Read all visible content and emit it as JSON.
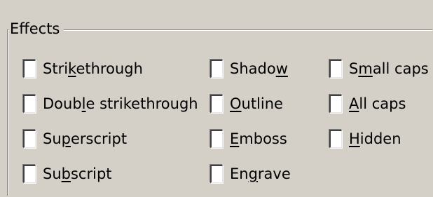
{
  "group": {
    "title": "Effects"
  },
  "columns": [
    {
      "items": [
        {
          "label": "Strikethrough",
          "accel_index": 4,
          "checked": false
        },
        {
          "label": "Double strikethrough",
          "accel_index": 4,
          "checked": false
        },
        {
          "label": "Superscript",
          "accel_index": 2,
          "checked": false
        },
        {
          "label": "Subscript",
          "accel_index": 2,
          "checked": false
        }
      ]
    },
    {
      "items": [
        {
          "label": "Shadow",
          "accel_index": 5,
          "checked": false
        },
        {
          "label": "Outline",
          "accel_index": 0,
          "checked": false
        },
        {
          "label": "Emboss",
          "accel_index": 0,
          "checked": false
        },
        {
          "label": "Engrave",
          "accel_index": 2,
          "checked": false
        }
      ]
    },
    {
      "items": [
        {
          "label": "Small caps",
          "accel_index": 1,
          "checked": false
        },
        {
          "label": "All caps",
          "accel_index": 0,
          "checked": false
        },
        {
          "label": "Hidden",
          "accel_index": 0,
          "checked": false
        }
      ]
    }
  ]
}
